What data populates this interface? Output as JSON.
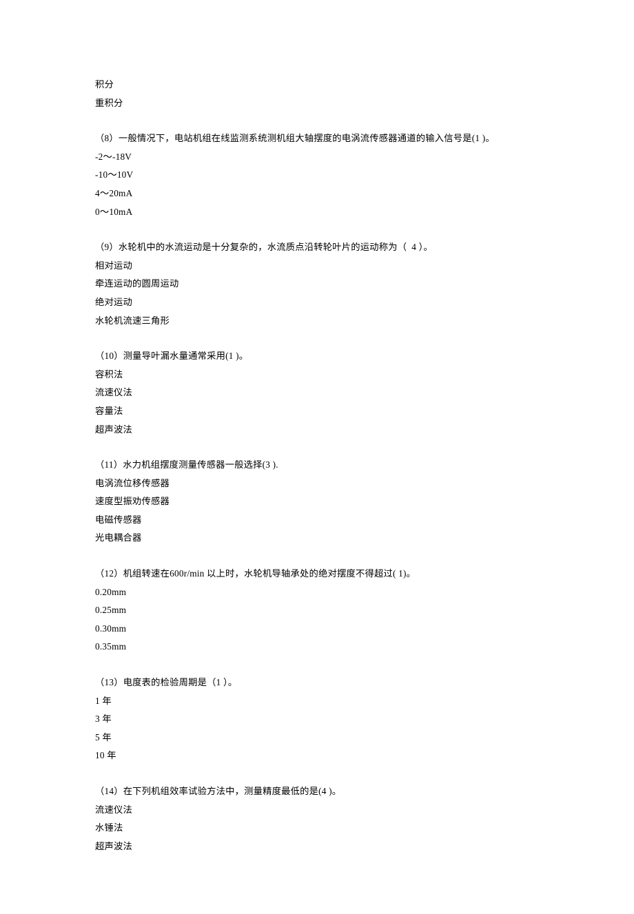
{
  "preamble": {
    "lines": [
      "积分",
      "重积分"
    ]
  },
  "questions": [
    {
      "stem": "（8）一般情况下，电站机组在线监测系统测机组大轴摆度的电涡流传感器通道的输入信号是(1 )。",
      "options": [
        "-2～-18V",
        "-10～10V",
        "4～20mA",
        "0～10mA"
      ]
    },
    {
      "stem": "（9）水轮机中的水流运动是十分复杂的，水流质点沿转轮叶片的运动称为（  4 ）。",
      "options": [
        "相对运动",
        "牵连运动的圆周运动",
        "绝对运动",
        "水轮机流速三角形"
      ]
    },
    {
      "stem": "（10）测量导叶漏水量通常采用(1 )。",
      "options": [
        "容积法",
        "流速仪法",
        "容量法",
        "超声波法"
      ]
    },
    {
      "stem": "（11）水力机组摆度测量传感器一般选择(3 ).",
      "options": [
        "电涡流位移传感器",
        "速度型振劝传感器",
        "电磁传感器",
        "光电耦合器"
      ]
    },
    {
      "stem": "（12）机组转速在600r/min 以上时，水轮机导轴承处的绝对摆度不得超过( 1)。",
      "options": [
        "0.20mm",
        "0.25mm",
        "0.30mm",
        "0.35mm"
      ]
    },
    {
      "stem": "（13）电度表的检验周期是（1 ）。",
      "options": [
        "1 年",
        "3 年",
        "5 年",
        "10 年"
      ]
    },
    {
      "stem": "（14）在下列机组效率试验方法中，测量精度最低的是(4 )。",
      "options": [
        "流速仪法",
        "水锤法",
        "超声波法"
      ]
    }
  ]
}
